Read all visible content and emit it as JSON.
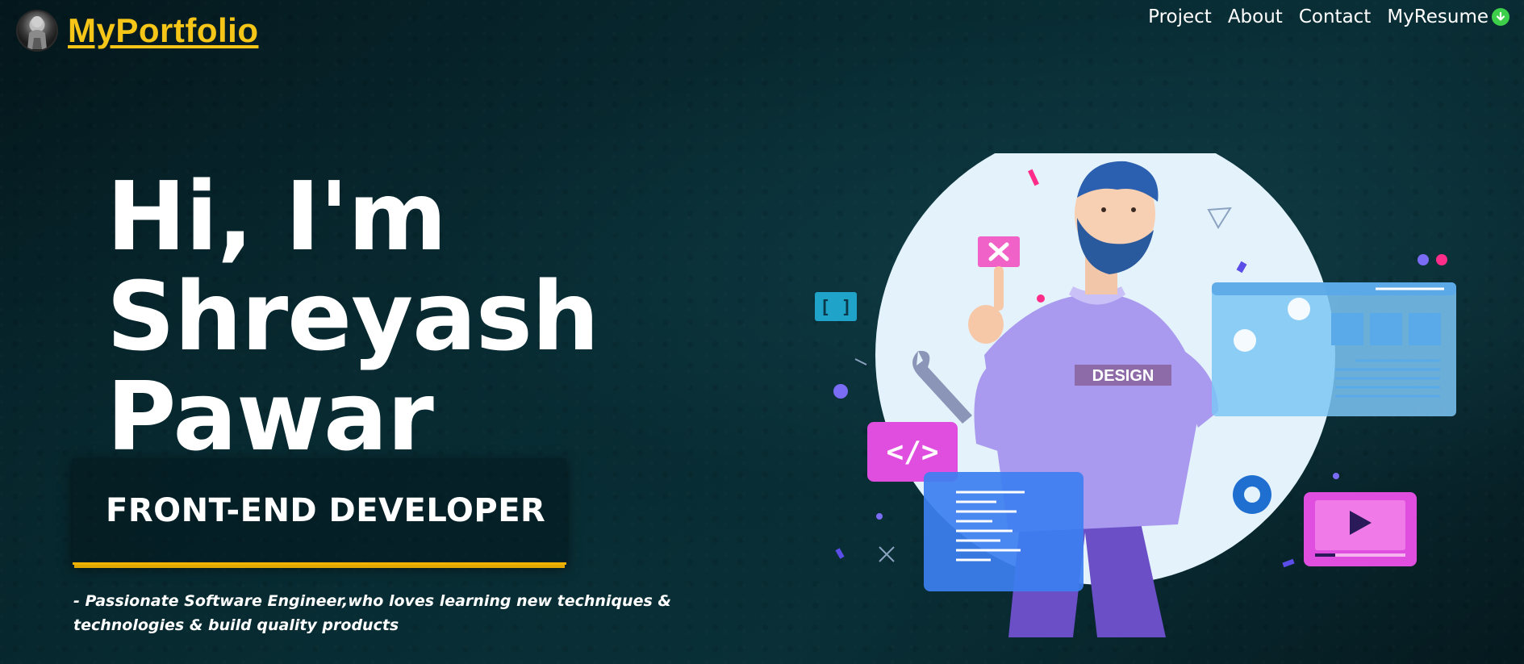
{
  "header": {
    "brand": "MyPortfolio",
    "nav": [
      {
        "label": "Project"
      },
      {
        "label": "About"
      },
      {
        "label": "Contact"
      },
      {
        "label": "MyResume",
        "icon": "download-icon"
      }
    ]
  },
  "hero": {
    "greeting": "Hi, I'm",
    "first_name": "Shreyash",
    "last_name": "Pawar",
    "role": "FRONT-END DEVELOPER",
    "tagline": "- Passionate Software Engineer,who loves learning new techniques & technologies & build quality products"
  },
  "illustration": {
    "shirt_text": "DESIGN",
    "code_symbol": "</>",
    "bracket_symbol": "[ ]"
  },
  "colors": {
    "brand": "#f5c518",
    "accent_border": "#f0b400",
    "download_icon": "#3ecf4a"
  }
}
